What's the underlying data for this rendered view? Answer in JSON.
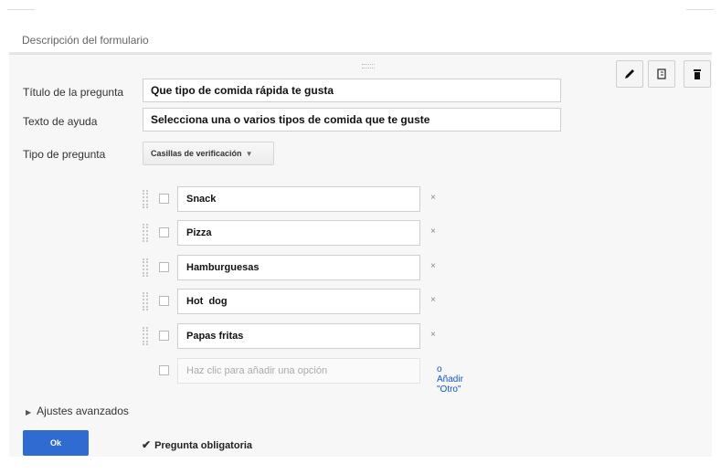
{
  "form": {
    "description_label": "Descripción del formulario"
  },
  "toolbar": {
    "edit_icon": "pencil-icon",
    "duplicate_icon": "duplicate-icon",
    "delete_icon": "trash-icon"
  },
  "question": {
    "title_label": "Título de la pregunta",
    "title_value": "Que tipo de comida rápida te gusta",
    "help_label": "Texto de ayuda",
    "help_value": "Selecciona una o varios tipos de comida que te guste",
    "type_label": "Tipo de pregunta",
    "type_value": "Casillas de verificación"
  },
  "options": [
    {
      "label": "Snack"
    },
    {
      "label": "Pizza"
    },
    {
      "label": "Hamburguesas"
    },
    {
      "label": "Hot  dog"
    },
    {
      "label": "Papas fritas"
    }
  ],
  "add_option": {
    "placeholder": "Haz clic para añadir una opción",
    "add_other": "o Añadir \"Otro\""
  },
  "remove_mark": "×",
  "advanced_settings": "Ajustes avanzados",
  "ok_button": "Ok",
  "required": {
    "checked": true,
    "label": "Pregunta obligatoria"
  }
}
